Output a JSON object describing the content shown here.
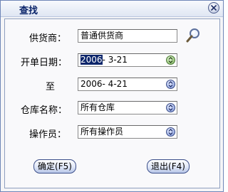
{
  "window": {
    "title": "查找"
  },
  "form": {
    "supplier": {
      "label": "供货商：",
      "value": "普通供货商"
    },
    "start_date": {
      "label": "开单日期：",
      "year_selected": "2006",
      "rest": "- 3-21"
    },
    "end_date": {
      "label": "至",
      "value": "2006- 4-21"
    },
    "warehouse": {
      "label": "仓库名称：",
      "value": "所有仓库"
    },
    "operator": {
      "label": "操作员：",
      "value": "所有操作员"
    }
  },
  "buttons": {
    "confirm": "确定(F5)",
    "exit": "退出(F4)"
  },
  "icons": {
    "close": "close-icon",
    "search": "magnifier-icon",
    "dropdown": "chevron-down-icon",
    "date": "date-spin-icon"
  },
  "colors": {
    "title_text": "#0a246a",
    "selection": "#0a246a",
    "frame": "#6f86b8"
  }
}
